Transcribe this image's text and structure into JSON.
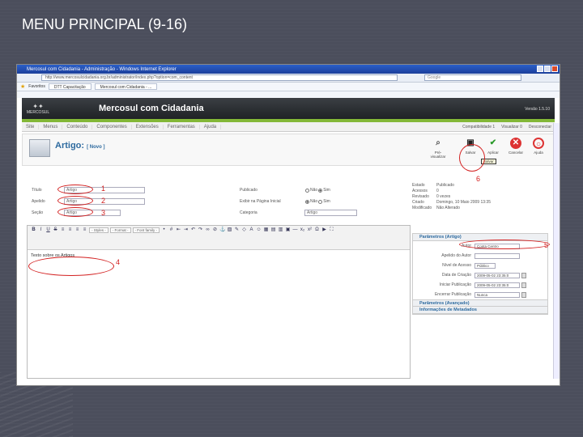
{
  "slide": {
    "title": "MENU PRINCIPAL (9-16)"
  },
  "browser": {
    "window_title": "Mercosul com Cidadania - Administração - Windows Internet Explorer",
    "address": "http://www.mercosulcidadania.org.br/administrator/index.php?option=com_content",
    "search_placeholder": "Google",
    "favorites_label": "Favoritos",
    "tabs": [
      "DTT Capacitação",
      "Mercosul com Cidadania - ..."
    ]
  },
  "joomla": {
    "logo_text": "MERCOSUL",
    "header_title": "Mercosul com Cidadania",
    "version": "Versão 1.5.10",
    "menu": [
      "Site",
      "Menus",
      "Conteúdo",
      "Componentes",
      "Extensões",
      "Ferramentas",
      "Ajuda"
    ],
    "status": [
      "Compatibilidade",
      "1",
      "Visualizar",
      "0",
      "Desconectar"
    ],
    "page_title": "Artigo:",
    "page_subtitle": "[ Novo ]",
    "toolbar": {
      "preview": "Pré-visualizar",
      "save": "Salvar",
      "apply": "Aplicar",
      "cancel": "Cancelar",
      "help": "Ajuda",
      "tooltip": "Salvar"
    }
  },
  "form": {
    "title_label": "Título",
    "title_value": "Artigo",
    "alias_label": "Apelido",
    "alias_value": "Artigo",
    "section_label": "Seção",
    "section_value": "Artigo",
    "published_label": "Publicado",
    "yes": "Sim",
    "no": "Não",
    "frontpage_label": "Exibir na Página Inicial",
    "category_label": "Categoria",
    "category_value": "Artigo"
  },
  "editor": {
    "styles": "- Styles -",
    "format": "- Format -",
    "font": "- Font family -",
    "body_text": "Texto sobre os Artigos"
  },
  "info": {
    "rows": [
      {
        "k": "Estado",
        "v": "Publicado"
      },
      {
        "k": "Acessos",
        "v": "0"
      },
      {
        "k": "Revisado",
        "v": "0 vezes"
      },
      {
        "k": "Criado",
        "v": "Domingo, 10 Maio 2009 13:35"
      },
      {
        "k": "Modificado",
        "v": "Não Alterado"
      }
    ]
  },
  "params": {
    "header": "Parâmetros (Artigo)",
    "author_label": "Autor",
    "author_value": "Conta Centro",
    "alias_author_label": "Apelido do Autor",
    "access_label": "Nível de Acesso",
    "access_value": "Público",
    "created_label": "Data de Criação",
    "created_value": "2009-05-02 23:35:0",
    "start_label": "Iniciar Publicação",
    "start_value": "2009-05-02 23:35:0",
    "end_label": "Encerrar Publicação",
    "end_value": "Nunca",
    "advanced": "Parâmetros (Avançado)",
    "metadata": "Informações de Metadados"
  },
  "annotations": [
    "1",
    "2",
    "3",
    "4",
    "5",
    "6"
  ],
  "colors": {
    "annotation": "#d32020",
    "header_green": "#83b737",
    "slide_bg": "#4b4e5c"
  }
}
